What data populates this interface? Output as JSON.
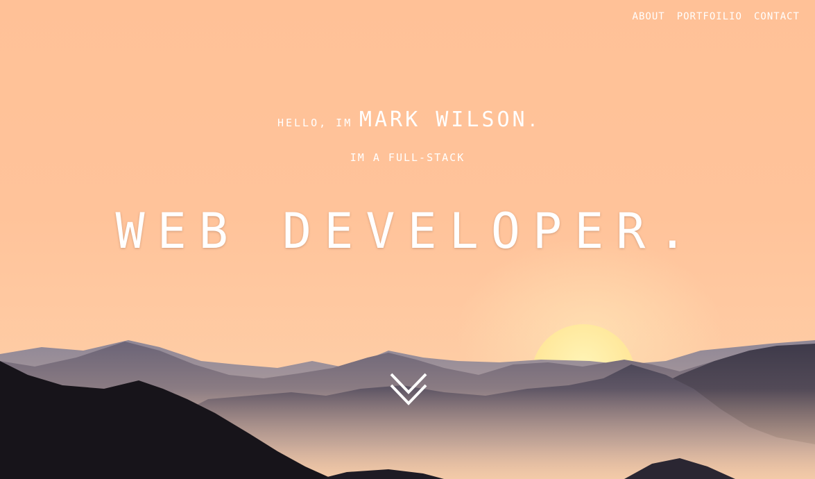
{
  "nav": {
    "items": [
      {
        "label": "ABOUT"
      },
      {
        "label": "PORTFOILIO"
      },
      {
        "label": "CONTACT"
      }
    ]
  },
  "hero": {
    "greeting": "HELLO, IM",
    "name": "MARK WILSON",
    "name_suffix": ".",
    "subtitle": "IM A FULL-STACK",
    "headline": "WEB DEVELOPER.",
    "scroll_icon": "double-chevron-down-icon"
  },
  "colors": {
    "sky": "#ffc197",
    "sun": "#ffe79a",
    "text": "#ffffff",
    "mountain_dark": "#17141a"
  }
}
